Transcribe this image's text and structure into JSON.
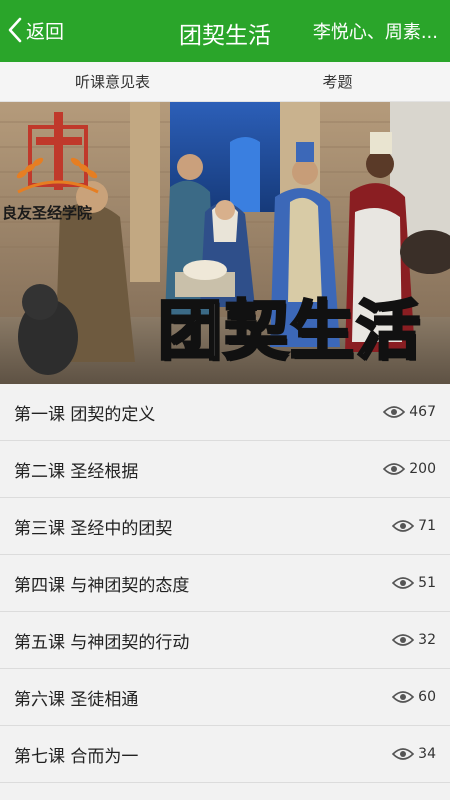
{
  "header": {
    "back_label": "返回",
    "title": "团契生活",
    "right_text": "李悦心、周素..."
  },
  "tabs": [
    {
      "label": "听课意见表"
    },
    {
      "label": "考题"
    }
  ],
  "banner": {
    "logo_text": "良友圣经学院",
    "title_text": "团契生活"
  },
  "lessons": [
    {
      "title": "第一课 团契的定义",
      "views": "467"
    },
    {
      "title": "第二课 圣经根据",
      "views": "200"
    },
    {
      "title": "第三课 圣经中的团契",
      "views": "71"
    },
    {
      "title": "第四课 与神团契的态度",
      "views": "51"
    },
    {
      "title": "第五课 与神团契的行动",
      "views": "32"
    },
    {
      "title": "第六课 圣徒相通",
      "views": "60"
    },
    {
      "title": "第七课 合而为一",
      "views": "34"
    }
  ],
  "colors": {
    "header_bg": "#2aa52a",
    "logo_red": "#c0392b",
    "logo_orange": "#e67e22"
  }
}
